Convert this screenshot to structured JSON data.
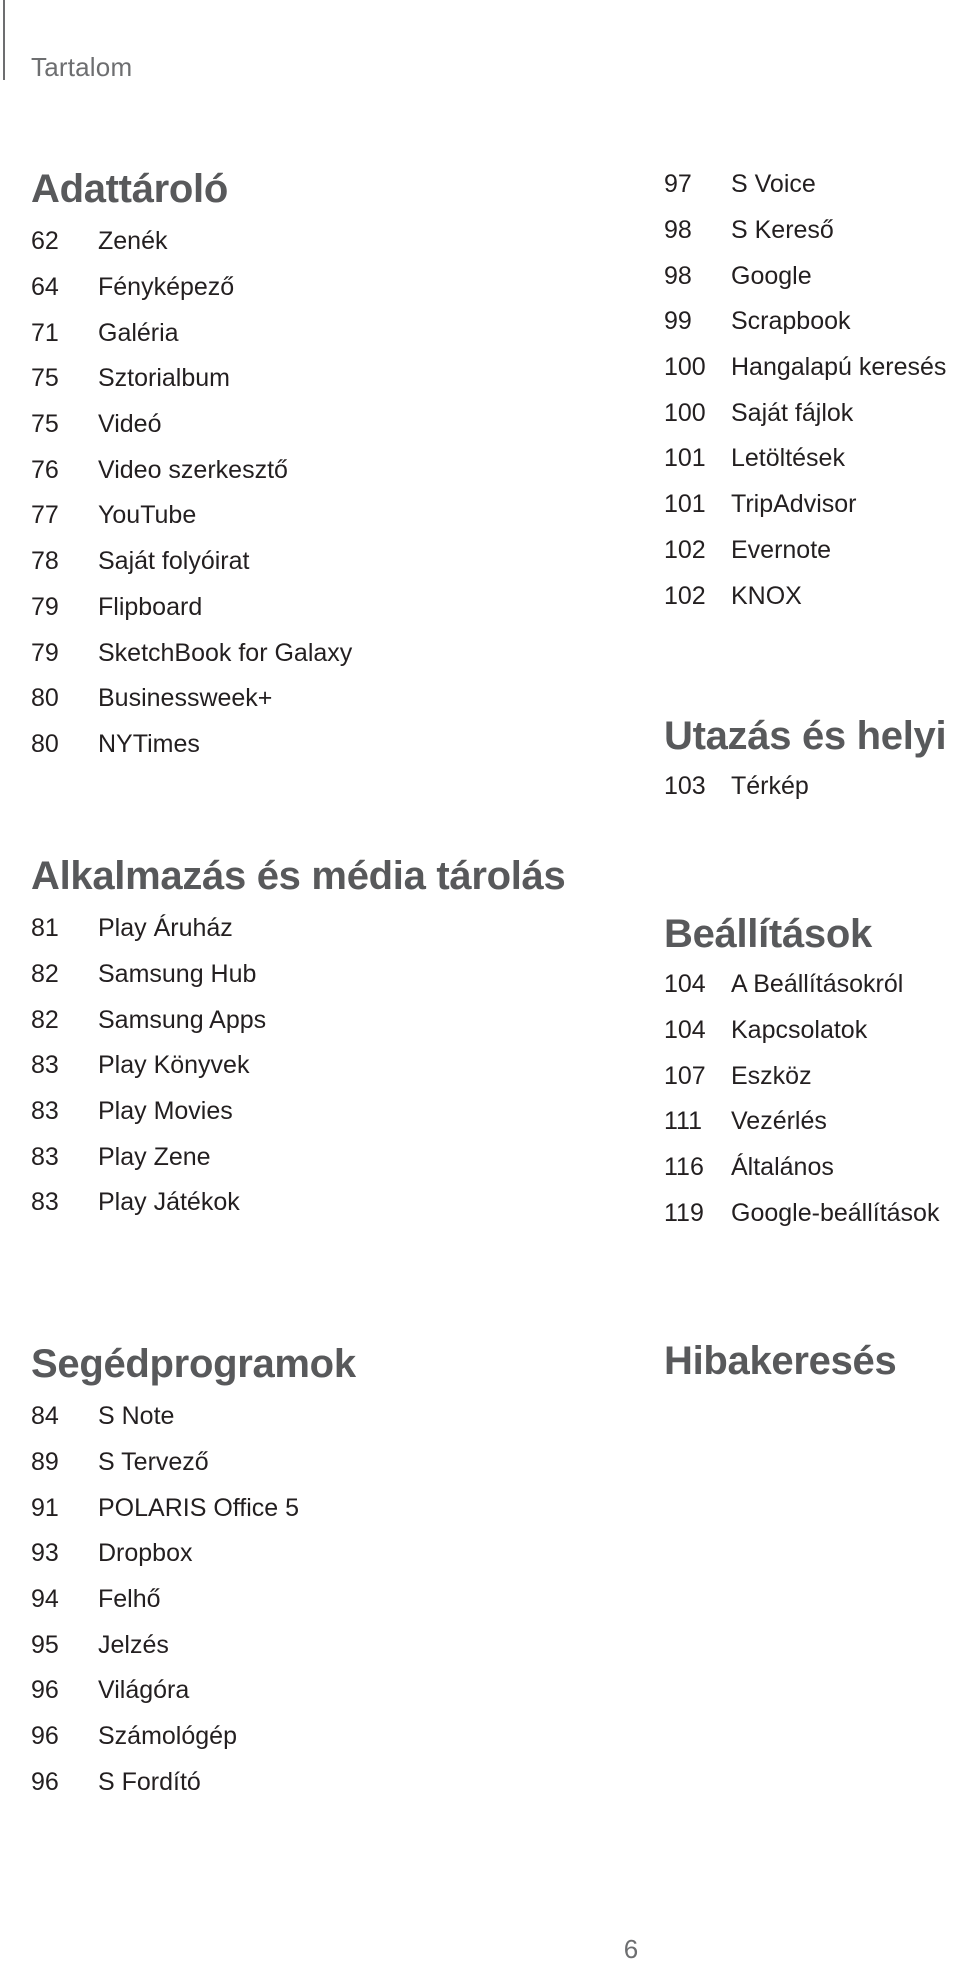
{
  "running_head": "Tartalom",
  "page_number": "6",
  "left_column": {
    "adattarolo": {
      "title": "Adattároló",
      "items": [
        {
          "page": "62",
          "label": "Zenék"
        },
        {
          "page": "64",
          "label": "Fényképező"
        },
        {
          "page": "71",
          "label": "Galéria"
        },
        {
          "page": "75",
          "label": "Sztorialbum"
        },
        {
          "page": "75",
          "label": "Videó"
        },
        {
          "page": "76",
          "label": "Video szerkesztő"
        },
        {
          "page": "77",
          "label": "YouTube"
        },
        {
          "page": "78",
          "label": "Saját folyóirat"
        },
        {
          "page": "79",
          "label": "Flipboard"
        },
        {
          "page": "79",
          "label": "SketchBook for Galaxy"
        },
        {
          "page": "80",
          "label": "Businessweek+"
        },
        {
          "page": "80",
          "label": "NYTimes"
        }
      ]
    },
    "alkalmazas": {
      "title": "Alkalmazás és média tárolás",
      "items": [
        {
          "page": "81",
          "label": "Play Áruház"
        },
        {
          "page": "82",
          "label": "Samsung Hub"
        },
        {
          "page": "82",
          "label": "Samsung Apps"
        },
        {
          "page": "83",
          "label": "Play Könyvek"
        },
        {
          "page": "83",
          "label": "Play Movies"
        },
        {
          "page": "83",
          "label": "Play Zene"
        },
        {
          "page": "83",
          "label": "Play Játékok"
        }
      ]
    },
    "segedprogramok": {
      "title": "Segédprogramok",
      "items": [
        {
          "page": "84",
          "label": "S Note"
        },
        {
          "page": "89",
          "label": "S Tervező"
        },
        {
          "page": "91",
          "label": "POLARIS Office 5"
        },
        {
          "page": "93",
          "label": "Dropbox"
        },
        {
          "page": "94",
          "label": "Felhő"
        },
        {
          "page": "95",
          "label": "Jelzés"
        },
        {
          "page": "96",
          "label": "Világóra"
        },
        {
          "page": "96",
          "label": "Számológép"
        },
        {
          "page": "96",
          "label": "S Fordító"
        }
      ]
    }
  },
  "right_column": {
    "segedprogramok_cont": {
      "items": [
        {
          "page": "97",
          "label": "S Voice"
        },
        {
          "page": "98",
          "label": "S Kereső"
        },
        {
          "page": "98",
          "label": "Google"
        },
        {
          "page": "99",
          "label": "Scrapbook"
        },
        {
          "page": "100",
          "label": "Hangalapú keresés"
        },
        {
          "page": "100",
          "label": "Saját fájlok"
        },
        {
          "page": "101",
          "label": "Letöltések"
        },
        {
          "page": "101",
          "label": "TripAdvisor"
        },
        {
          "page": "102",
          "label": "Evernote"
        },
        {
          "page": "102",
          "label": "KNOX"
        }
      ]
    },
    "utazas": {
      "title": "Utazás és helyi",
      "items": [
        {
          "page": "103",
          "label": "Térkép"
        }
      ]
    },
    "beallitasok": {
      "title": "Beállítások",
      "items": [
        {
          "page": "104",
          "label": "A Beállításokról"
        },
        {
          "page": "104",
          "label": "Kapcsolatok"
        },
        {
          "page": "107",
          "label": "Eszköz"
        },
        {
          "page": "111",
          "label": "Vezérlés"
        },
        {
          "page": "116",
          "label": "Általános"
        },
        {
          "page": "119",
          "label": "Google-beállítások"
        }
      ]
    },
    "hibakereses": {
      "title": "Hibakeresés"
    }
  }
}
